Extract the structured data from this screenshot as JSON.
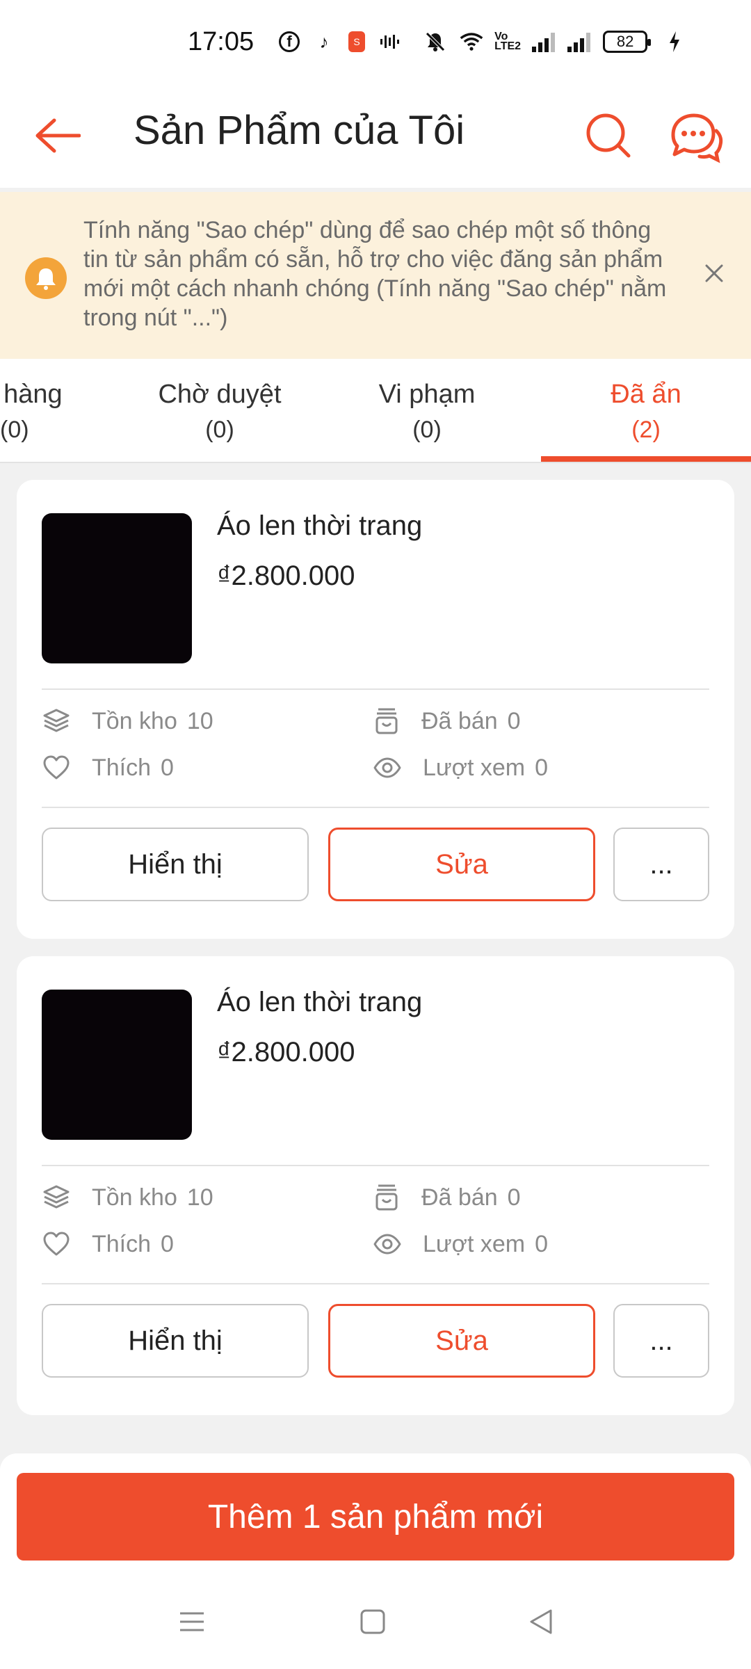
{
  "status_bar": {
    "time": "17:05",
    "battery": "82",
    "icons": [
      "facebook-icon",
      "tiktok-icon",
      "shopeepay-icon",
      "sound-wave-icon",
      "mute-icon",
      "wifi-icon",
      "volte-icon",
      "signal-icon",
      "signal-icon",
      "battery-icon",
      "charging-icon"
    ]
  },
  "header": {
    "title": "Sản Phẩm của Tôi",
    "accent_color": "#ee4d2d"
  },
  "banner": {
    "text": "Tính năng \"Sao chép\" dùng để sao chép một số thông tin từ sản phẩm có sẵn, hỗ trợ cho việc đăng sản phẩm mới một cách nhanh chóng (Tính năng \"Sao chép\" nằm trong nút \"...\")"
  },
  "tabs": [
    {
      "label": "t hàng",
      "count": "(0)",
      "active": false
    },
    {
      "label": "Chờ duyệt",
      "count": "(0)",
      "active": false
    },
    {
      "label": "Vi phạm",
      "count": "(0)",
      "active": false
    },
    {
      "label": "Đã ẩn",
      "count": "(2)",
      "active": true
    }
  ],
  "products": [
    {
      "name": "Áo len thời trang",
      "price": "₫2.800.000",
      "stock_label": "Tồn kho",
      "stock": "10",
      "sold_label": "Đã bán",
      "sold": "0",
      "likes_label": "Thích",
      "likes": "0",
      "views_label": "Lượt xem",
      "views": "0",
      "show_label": "Hiển thị",
      "edit_label": "Sửa",
      "more_label": "..."
    },
    {
      "name": "Áo len thời trang",
      "price": "₫2.800.000",
      "stock_label": "Tồn kho",
      "stock": "10",
      "sold_label": "Đã bán",
      "sold": "0",
      "likes_label": "Thích",
      "likes": "0",
      "views_label": "Lượt xem",
      "views": "0",
      "show_label": "Hiển thị",
      "edit_label": "Sửa",
      "more_label": "..."
    }
  ],
  "add_button": {
    "label": "Thêm 1 sản phẩm mới"
  }
}
